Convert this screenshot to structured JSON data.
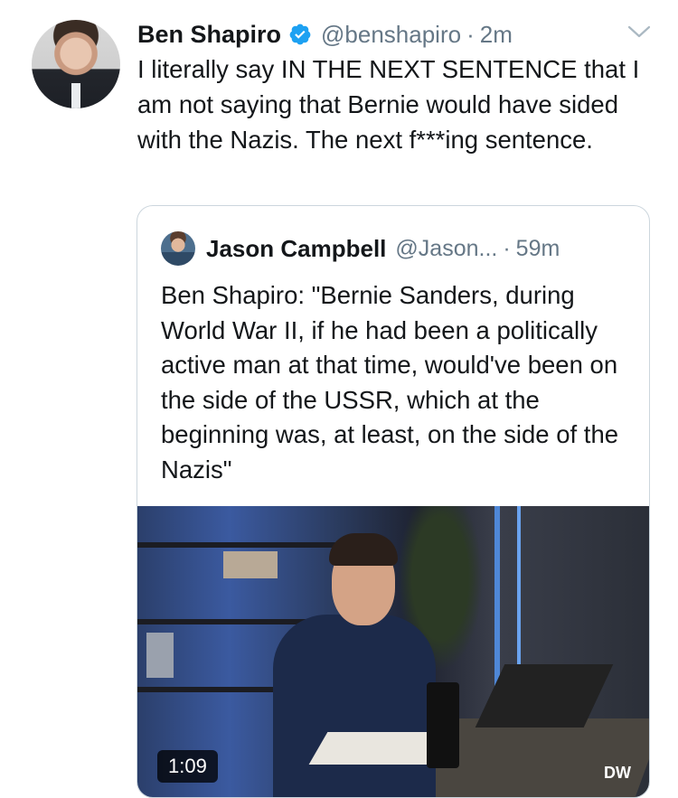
{
  "tweet": {
    "author_name": "Ben Shapiro",
    "author_handle": "@benshapiro",
    "separator": "·",
    "time": "2m",
    "text": "I literally say IN THE NEXT SENTENCE that I am not saying that Bernie would have sided with the Nazis. The next f***ing sentence.",
    "verified_icon": "verified-badge-icon",
    "menu_icon": "chevron-down-icon",
    "colors": {
      "verified": "#1da1f2",
      "secondary_text": "#657786",
      "border": "#ccd6dd"
    }
  },
  "quoted": {
    "author_name": "Jason Campbell",
    "author_handle": "@Jason...",
    "separator": "·",
    "time": "59m",
    "text": "Ben Shapiro: \"Bernie Sanders, during World War II, if he had been a politically active man at that time, would've been on the side of the USSR, which at the beginning was, at least, on the side of the Nazis\"",
    "video": {
      "duration": "1:09",
      "watermark": "DW"
    }
  }
}
